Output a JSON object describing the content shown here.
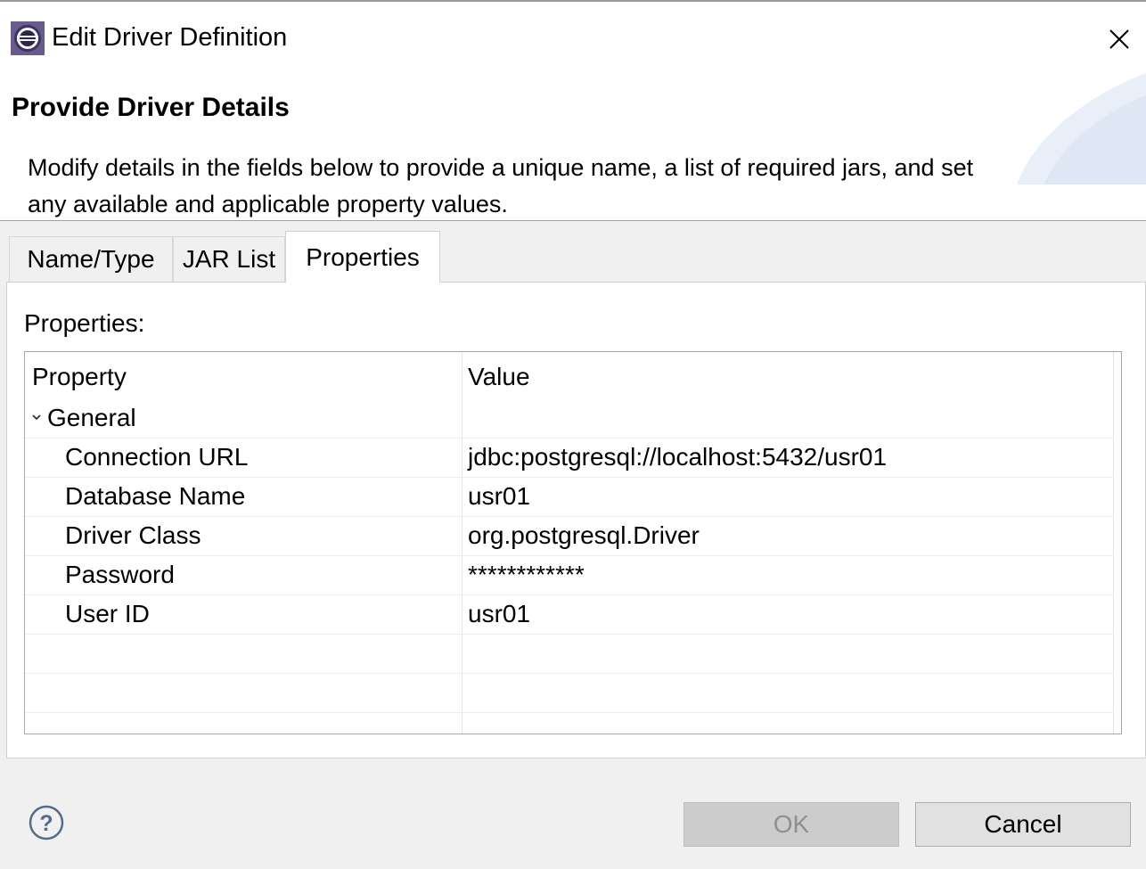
{
  "window": {
    "title": "Edit Driver Definition",
    "app_icon": "eclipse-icon",
    "close_icon": "close-icon"
  },
  "header": {
    "title": "Provide Driver Details",
    "description": "Modify details in the fields below to provide a unique name, a list of required jars, and set any available and applicable property values."
  },
  "tabs": [
    {
      "label": "Name/Type",
      "active": false
    },
    {
      "label": "JAR List",
      "active": false
    },
    {
      "label": "Properties",
      "active": true
    }
  ],
  "properties": {
    "label": "Properties:",
    "columns": {
      "property": "Property",
      "value": "Value"
    },
    "group": {
      "label": "General",
      "expanded": true
    },
    "rows": [
      {
        "name": "Connection URL",
        "value": "jdbc:postgresql://localhost:5432/usr01"
      },
      {
        "name": "Database Name",
        "value": "usr01"
      },
      {
        "name": "Driver Class",
        "value": "org.postgresql.Driver"
      },
      {
        "name": "Password",
        "value": "************"
      },
      {
        "name": "User ID",
        "value": "usr01"
      }
    ]
  },
  "buttons": {
    "ok": "OK",
    "cancel": "Cancel",
    "ok_enabled": false
  },
  "colors": {
    "ok_disabled_bg": "#cccccc",
    "cancel_bg": "#e1e1e1",
    "dialog_bg": "#f0f0f0"
  },
  "help_icon": "help-icon"
}
